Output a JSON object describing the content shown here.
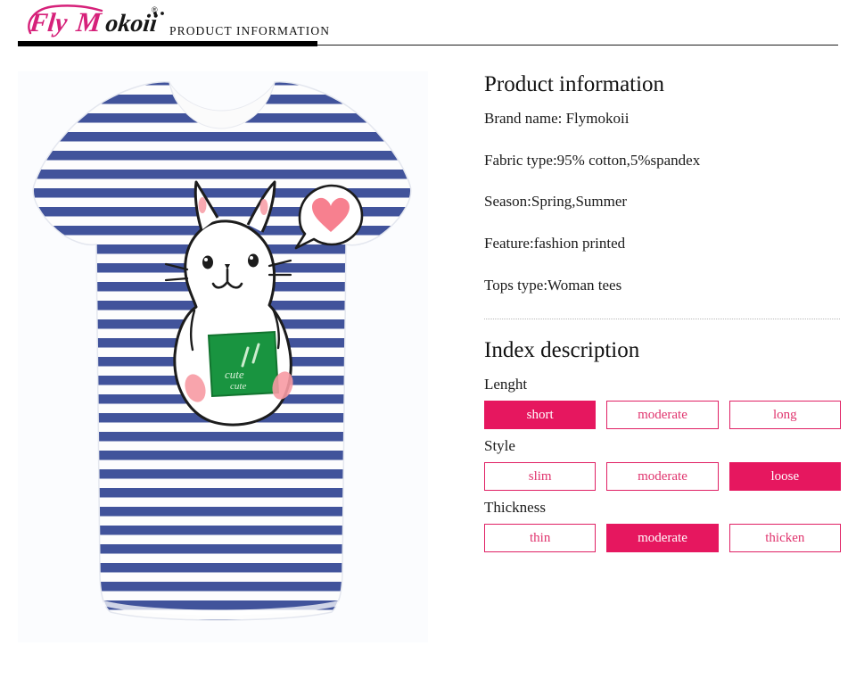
{
  "header": {
    "brand_logo_fly": "Fly",
    "brand_logo_m": "M",
    "brand_logo_okoii": "okoii",
    "registered_mark": "®",
    "title": "PRODUCT  INFORMATION"
  },
  "photo": {
    "alt": "Navy and white striped short-sleeve woman tee with cartoon bunny print holding a green block labeled cute, with a pink heart speech bubble",
    "stripe_color": "#41539b",
    "shirt_base_color": "#ffffff",
    "print_green": "#199440",
    "print_pink": "#f68a93",
    "background_color": "#fbfcfe"
  },
  "product_information": {
    "heading": "Product information",
    "specs": [
      "Brand name: Flymokoii",
      "Fabric type:95% cotton,5%spandex",
      "Season:Spring,Summer",
      "Feature:fashion printed",
      "Tops type:Woman tees"
    ]
  },
  "index_description": {
    "heading": "Index description",
    "accent_color": "#e6175f",
    "groups": [
      {
        "label": "Lenght",
        "options": [
          {
            "label": "short",
            "selected": true
          },
          {
            "label": "moderate",
            "selected": false
          },
          {
            "label": "long",
            "selected": false
          }
        ]
      },
      {
        "label": "Style",
        "options": [
          {
            "label": "slim",
            "selected": false
          },
          {
            "label": "moderate",
            "selected": false
          },
          {
            "label": "loose",
            "selected": true
          }
        ]
      },
      {
        "label": "Thickness",
        "options": [
          {
            "label": "thin",
            "selected": false
          },
          {
            "label": "moderate",
            "selected": true
          },
          {
            "label": "thicken",
            "selected": false
          }
        ]
      }
    ]
  }
}
